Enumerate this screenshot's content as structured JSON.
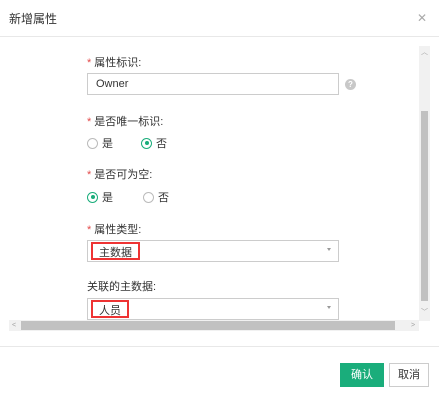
{
  "dialog": {
    "title": "新增属性",
    "close_icon": "close-icon"
  },
  "form": {
    "identifier": {
      "label": "属性标识:",
      "value": "Owner",
      "help_icon": "question-icon"
    },
    "unique": {
      "label": "是否唯一标识:",
      "options": [
        "是",
        "否"
      ],
      "selected": "否"
    },
    "nullable": {
      "label": "是否可为空:",
      "options": [
        "是",
        "否"
      ],
      "selected": "是"
    },
    "type": {
      "label": "属性类型:",
      "value": "主数据"
    },
    "master": {
      "label": "关联的主数据:",
      "value": "人员"
    }
  },
  "footer": {
    "confirm": "确认",
    "cancel": "取消"
  },
  "colors": {
    "accent": "#1aad7b",
    "required": "#e34a4a",
    "highlight": "#e33333"
  }
}
